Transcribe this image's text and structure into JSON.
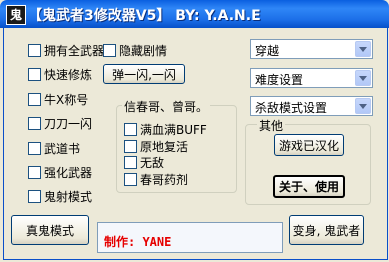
{
  "window": {
    "title_icon_glyph": "鬼",
    "title": "【鬼武者3修改器V5】 BY: Y.A.N.E"
  },
  "checkboxes": {
    "all_weapons": "拥有全武器",
    "hide_story": "隐藏剧情",
    "fast_train": "快速修炼",
    "ox_title": "牛X称号",
    "blade": "刀刀一闪",
    "martial_book": "武道书",
    "strong_weapon": "强化武器",
    "ghost_mode": "鬼射模式"
  },
  "buttons": {
    "flash": "弹一闪,一闪",
    "true_ghost": "真鬼模式",
    "chinese": "游戏已汉化",
    "about": "关于、使用",
    "transform": "变身, 鬼武者"
  },
  "combos": {
    "travel": "穿越",
    "difficulty": "难度设置",
    "kill_mode": "杀敌模式设置"
  },
  "group_xinge": {
    "label": "信春哥、曾哥。",
    "items": [
      "满血满BUFF",
      "原地复活",
      "无敌",
      "春哥药剂"
    ]
  },
  "group_other": {
    "label": "其他"
  },
  "author": "制作: YANE"
}
